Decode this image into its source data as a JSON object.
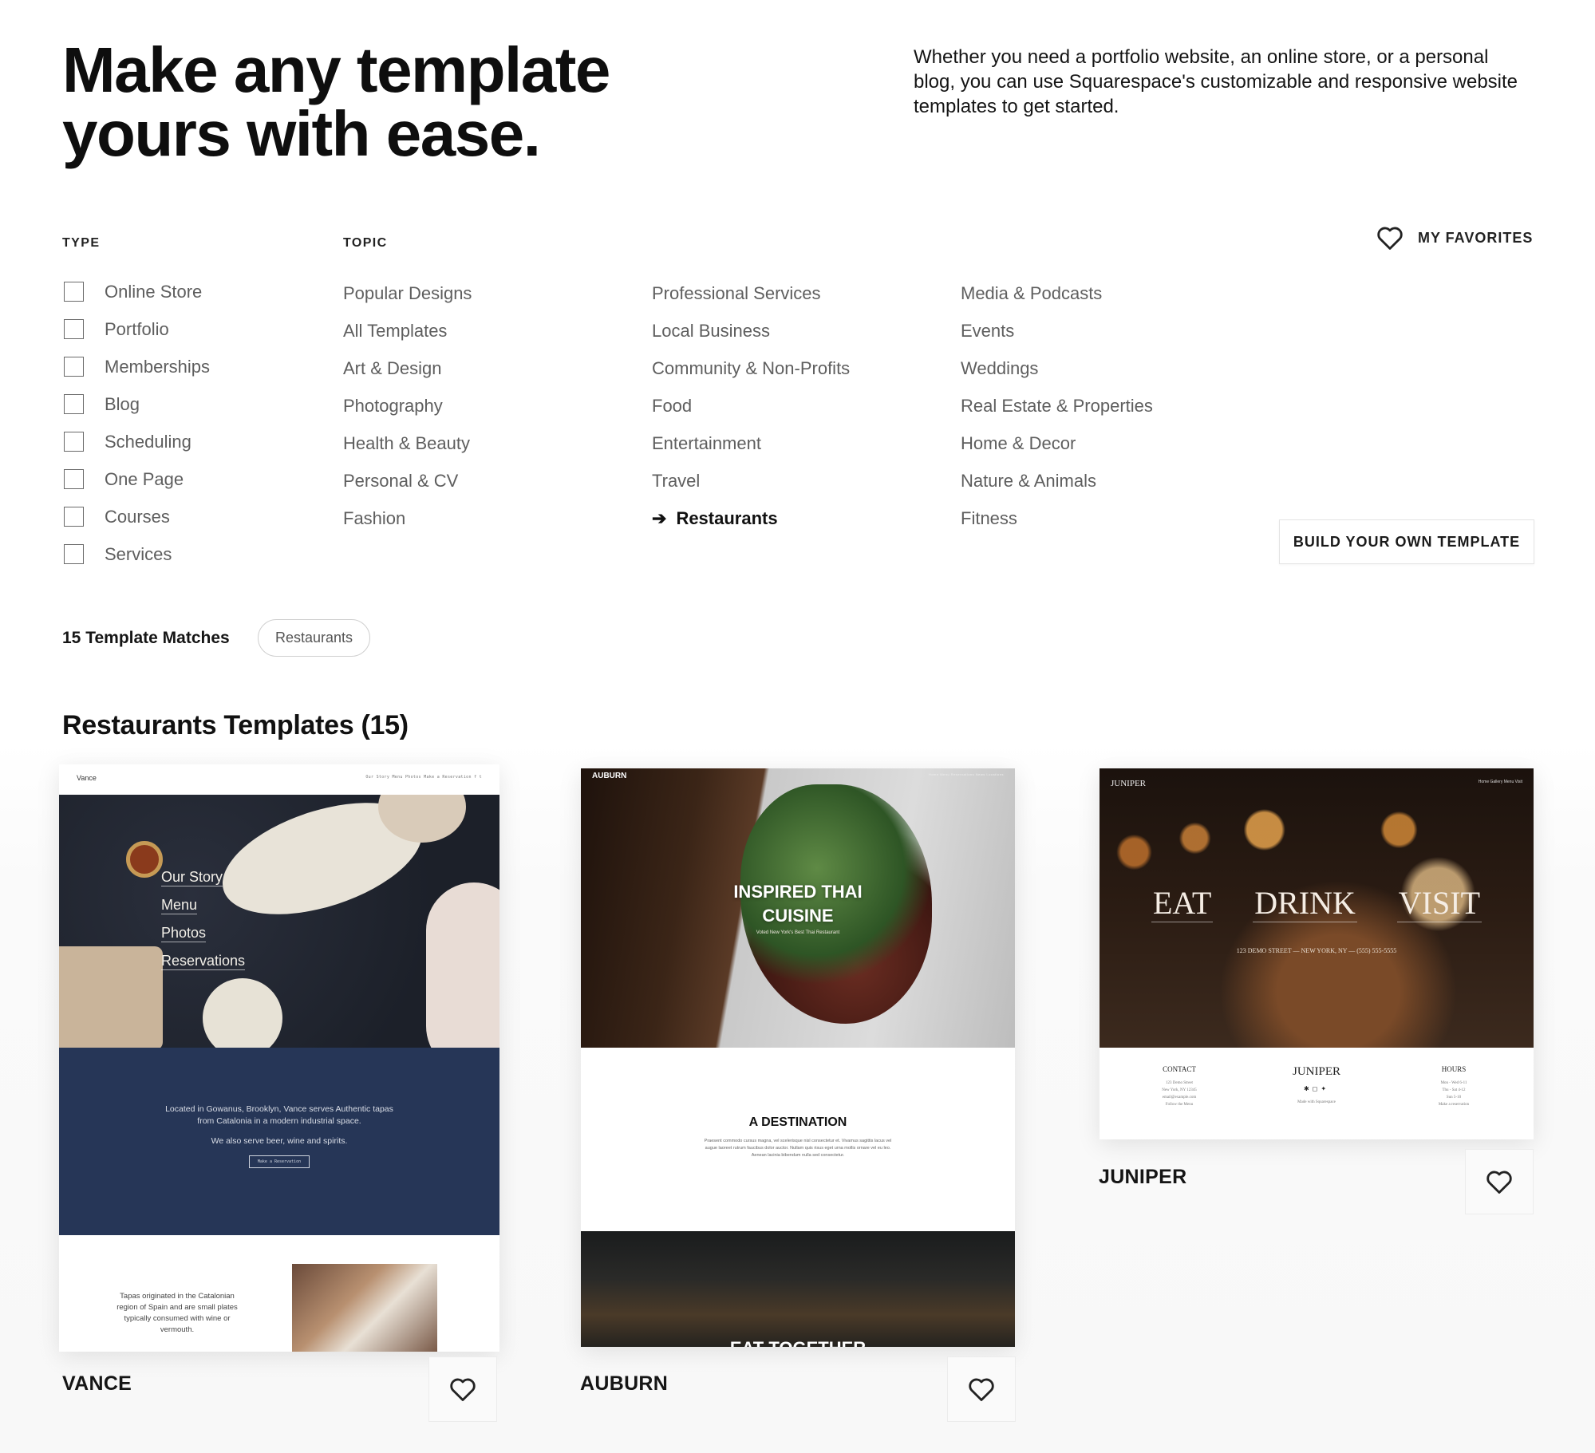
{
  "hero": {
    "title_line1": "Make any template",
    "title_line2": "yours with ease.",
    "description": "Whether you need a portfolio website, an online store, or a personal blog, you can use Squarespace's customizable and responsive website templates to get started."
  },
  "filters": {
    "type_heading": "TYPE",
    "topic_heading": "TOPIC",
    "types": [
      {
        "label": "Online Store",
        "checked": false
      },
      {
        "label": "Portfolio",
        "checked": false
      },
      {
        "label": "Memberships",
        "checked": false
      },
      {
        "label": "Blog",
        "checked": false
      },
      {
        "label": "Scheduling",
        "checked": false
      },
      {
        "label": "One Page",
        "checked": false
      },
      {
        "label": "Courses",
        "checked": false
      },
      {
        "label": "Services",
        "checked": false
      }
    ],
    "topics_col1": [
      "Popular Designs",
      "All Templates",
      "Art & Design",
      "Photography",
      "Health & Beauty",
      "Personal & CV",
      "Fashion"
    ],
    "topics_col2": [
      "Professional Services",
      "Local Business",
      "Community & Non-Profits",
      "Food",
      "Entertainment",
      "Travel",
      "Restaurants"
    ],
    "topics_col3": [
      "Media & Podcasts",
      "Events",
      "Weddings",
      "Real Estate & Properties",
      "Home & Decor",
      "Nature & Animals",
      "Fitness"
    ],
    "active_topic": "Restaurants",
    "active_indicator_icon": "arrow-right-icon"
  },
  "favorites": {
    "label": "MY FAVORITES",
    "icon": "heart-outline-icon"
  },
  "build_button": {
    "label": "BUILD YOUR OWN TEMPLATE"
  },
  "results": {
    "matches_label": "15 Template Matches",
    "active_chip": "Restaurants",
    "section_title": "Restaurants Templates (15)"
  },
  "templates": [
    {
      "name": "VANCE",
      "favorite_icon": "heart-outline-icon",
      "preview": {
        "logo": "Vance",
        "nav": "Our Story   Menu   Photos   Make a Reservation   f  t",
        "menu": [
          "Our Story",
          "Menu",
          "Photos",
          "Reservations"
        ],
        "about_line1": "Located in Gowanus, Brooklyn, Vance serves Authentic tapas from Catalonia in a modern industrial space.",
        "about_line2": "We also serve beer, wine and spirits.",
        "cta": "Make a Reservation",
        "bottom_text": "Tapas originated in the Catalonian region of Spain and are small plates typically consumed with wine or vermouth.",
        "accent_color": "#263657"
      }
    },
    {
      "name": "AUBURN",
      "favorite_icon": "heart-outline-icon",
      "preview": {
        "logo": "AUBURN",
        "nav": "Home   Menu   Reservations   News   Locations",
        "headline_line1": "INSPIRED THAI",
        "headline_line2": "CUISINE",
        "subline": "Voted New York's Best Thai Restaurant",
        "section_heading": "A DESTINATION",
        "section_body": "Praesent commodo cursus magna, vel scelerisque nisl consectetur et. Vivamus sagittis lacus vel augue laoreet rutrum faucibus dolor auctor. Nullam quis risus eget urna mollis ornare vel eu leo. Aenean lacinia bibendum nulla sed consectetur.",
        "bottom_headline": "EAT TOGETHER"
      }
    },
    {
      "name": "JUNIPER",
      "favorite_icon": "heart-outline-icon",
      "preview": {
        "logo": "JUNIPER",
        "nav": "Home   Gallery   Menu   Visit",
        "words": [
          "EAT",
          "DRINK",
          "VISIT"
        ],
        "address": "123 DEMO STREET — NEW YORK, NY — (555) 555-5555",
        "footer_contact_heading": "CONTACT",
        "footer_contact_text": "123 Demo Street\nNew York, NY 12345\nemail@example.com\nFollow the Menu",
        "footer_center_logo": "JUNIPER",
        "footer_made_with": "Made with Squarespace",
        "footer_hours_heading": "HOURS",
        "footer_hours_text": "Mon - Wed 6-11\nThu - Sat 4-12\nSun 5-10\nMake a reservation"
      }
    }
  ]
}
